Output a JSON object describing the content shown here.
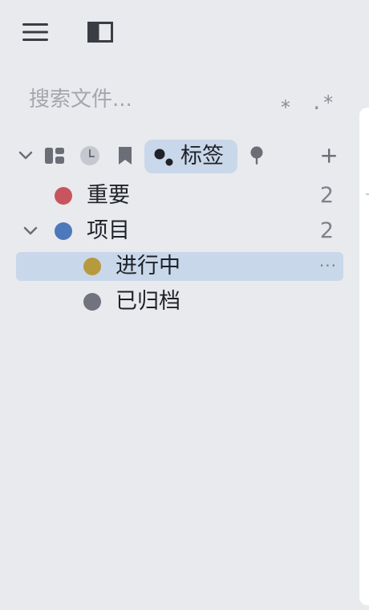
{
  "toolbar": {
    "menu_icon": "hamburger-icon",
    "layout_icon": "sidebar-toggle-icon"
  },
  "search": {
    "placeholder": "搜索文件...",
    "value": "",
    "wildcard_label": "*",
    "regex_label": ".*"
  },
  "views": [
    {
      "icon": "chevron-down-icon"
    },
    {
      "icon": "dashboard-icon"
    },
    {
      "icon": "clock-icon"
    },
    {
      "icon": "bookmark-icon"
    },
    {
      "icon": "tags-icon",
      "label": "标签",
      "active": true
    },
    {
      "icon": "pin-icon"
    },
    {
      "icon": "plus-icon"
    }
  ],
  "tags": [
    {
      "label": "重要",
      "count": "2",
      "color": "#c8555e",
      "level": 0
    },
    {
      "label": "项目",
      "count": "2",
      "color": "#4d78bb",
      "level": 0,
      "expanded": true
    },
    {
      "label": "进行中",
      "count": "",
      "color": "#b59a3e",
      "level": 1,
      "selected": true,
      "more": "···"
    },
    {
      "label": "已归档",
      "count": "",
      "color": "#71737f",
      "level": 1
    }
  ],
  "colors": {
    "background": "#e9eaed",
    "selected": "#c9d7ea",
    "text": "#1f2228",
    "muted": "#7e818a"
  }
}
